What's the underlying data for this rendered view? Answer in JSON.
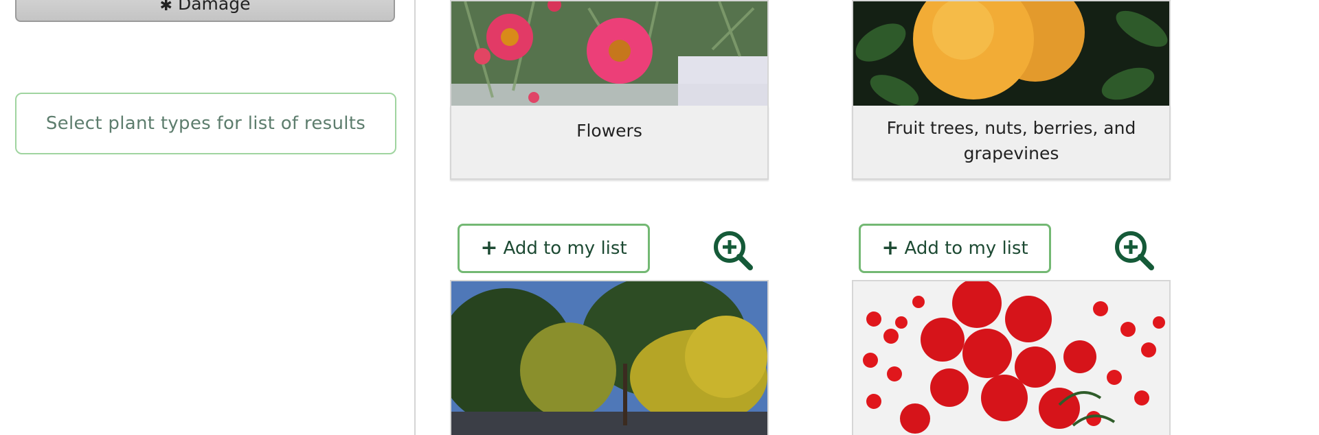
{
  "sidebar": {
    "damage_button_label": "Damage",
    "hint_text": "Select plant types for list of results"
  },
  "cards": [
    {
      "caption": "Flowers",
      "image_subject": "pink daisies"
    },
    {
      "caption": "Fruit trees, nuts, berries, and grapevines",
      "image_subject": "oranges on tree"
    },
    {
      "add_label": "Add to my list",
      "image_subject": "flowering trees"
    },
    {
      "add_label": "Add to my list",
      "image_subject": "red tomatoes"
    }
  ],
  "colors": {
    "accent_green": "#1d4a33",
    "border_green": "#73b873",
    "hint_border": "#9fd49f",
    "caption_bg": "#efefef"
  },
  "icons": {
    "damage": "bug-icon",
    "add": "plus-icon",
    "zoom": "zoom-in-icon"
  }
}
